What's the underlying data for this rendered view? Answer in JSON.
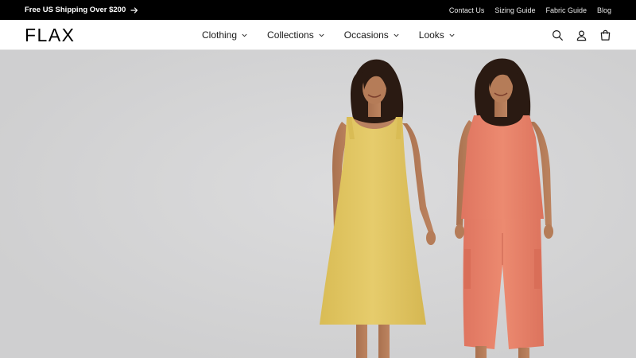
{
  "announcement": {
    "promo_text": "Free US Shipping Over $200",
    "links": [
      "Contact Us",
      "Sizing Guide",
      "Fabric Guide",
      "Blog"
    ]
  },
  "header": {
    "logo": "FLAX",
    "nav": [
      {
        "label": "Clothing"
      },
      {
        "label": "Collections"
      },
      {
        "label": "Occasions"
      },
      {
        "label": "Looks"
      }
    ],
    "icons": [
      "search-icon",
      "account-icon",
      "cart-icon"
    ]
  },
  "hero": {
    "models": [
      {
        "outfit": "yellow linen sleeveless dress",
        "color": "#e2c867"
      },
      {
        "outfit": "coral linen tank and cropped wide pants",
        "color": "#e9836a"
      }
    ],
    "background": "#d5d5d6"
  },
  "colors": {
    "announcement_bg": "#000000",
    "header_bg": "#ffffff",
    "text": "#121212"
  }
}
